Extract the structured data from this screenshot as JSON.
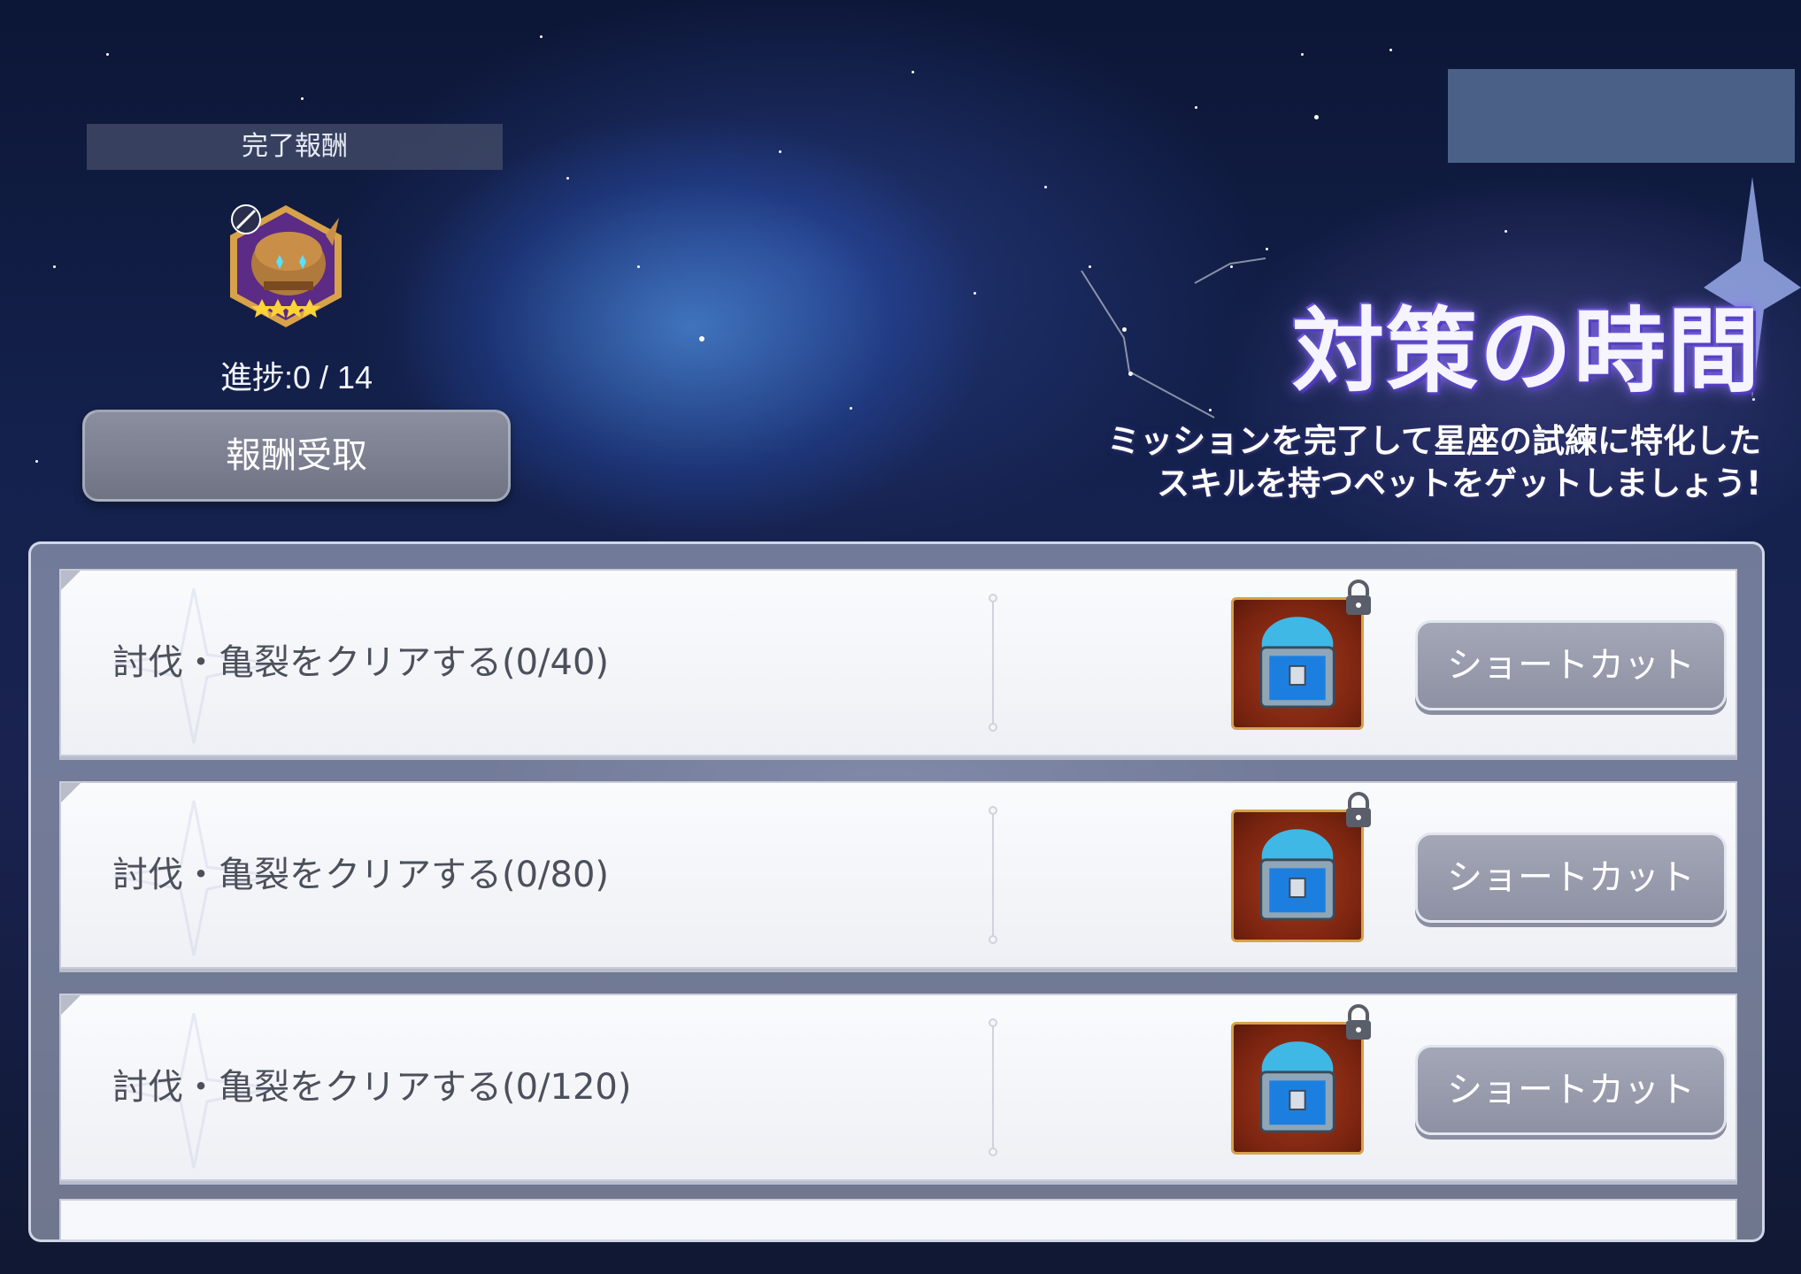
{
  "reward": {
    "header": "完了報酬",
    "progress_label": "進捗:0 / 14",
    "claim_button": "報酬受取"
  },
  "event": {
    "title": "対策の時間",
    "description_line1": "ミッションを完了して星座の試練に特化した",
    "description_line2": "スキルを持つペットをゲットしましょう!"
  },
  "missions": [
    {
      "text": "討伐・亀裂をクリアする(0/40)",
      "button": "ショートカット",
      "locked": true
    },
    {
      "text": "討伐・亀裂をクリアする(0/80)",
      "button": "ショートカット",
      "locked": true
    },
    {
      "text": "討伐・亀裂をクリアする(0/120)",
      "button": "ショートカット",
      "locked": true
    }
  ],
  "colors": {
    "title_glow": "#6a55d8",
    "button_gray": "#8d91a3",
    "chest_frame": "#d6a24a",
    "masked_box": "#4a6087"
  },
  "icons": {
    "reward": "helmet-pet-icon",
    "mission_reward": "treasure-chest-icon",
    "lock": "lock-icon"
  }
}
